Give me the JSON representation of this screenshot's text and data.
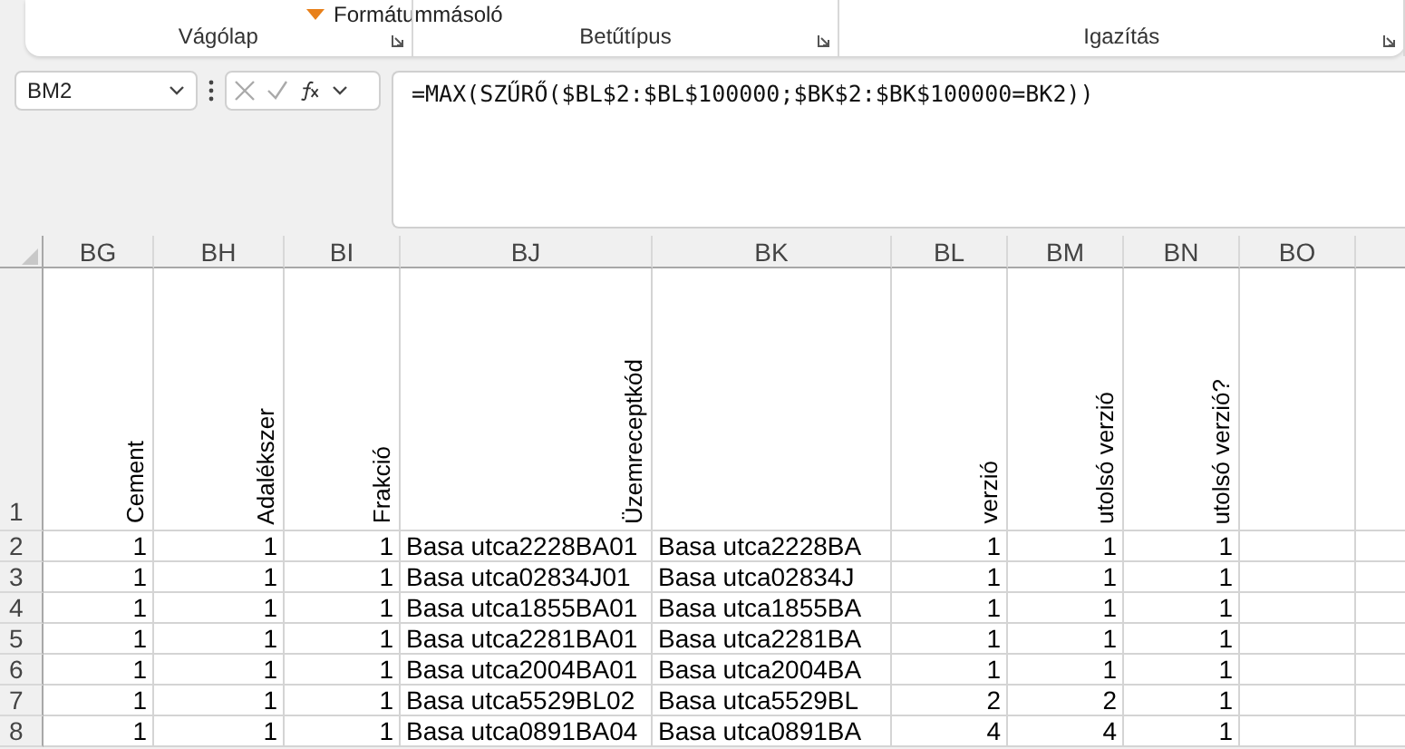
{
  "ribbon": {
    "top_item": "Formátummásoló",
    "groups": [
      {
        "label": "Vágólap"
      },
      {
        "label": "Betűtípus"
      },
      {
        "label": "Igazítás"
      }
    ]
  },
  "formula_bar": {
    "name_box": "BM2",
    "formula": "=MAX(SZŰRŐ($BL$2:$BL$100000;$BK$2:$BK$100000=BK2))"
  },
  "sheet": {
    "columns": [
      {
        "letter": "BG",
        "kind": "number",
        "header": "Cement"
      },
      {
        "letter": "BH",
        "kind": "number",
        "header": "Adalékszer"
      },
      {
        "letter": "BI",
        "kind": "number",
        "header": "Frakció"
      },
      {
        "letter": "BJ",
        "kind": "text",
        "header": "Üzemreceptkód"
      },
      {
        "letter": "BK",
        "kind": "text"
      },
      {
        "letter": "BL",
        "kind": "number",
        "header": "verzió"
      },
      {
        "letter": "BM",
        "kind": "number",
        "header": "utolsó verzió"
      },
      {
        "letter": "BN",
        "kind": "number",
        "header": "utolsó verzió?"
      },
      {
        "letter": "BO",
        "kind": "empty"
      },
      {
        "kind": "empty"
      }
    ],
    "header_row_number": "1",
    "rows": [
      {
        "number": "2",
        "cells": [
          "1",
          "1",
          "1",
          "Basa utca2228BA01",
          "Basa utca2228BA",
          "1",
          "1",
          "1"
        ]
      },
      {
        "number": "3",
        "cells": [
          "1",
          "1",
          "1",
          "Basa utca02834J01",
          "Basa utca02834J",
          "1",
          "1",
          "1"
        ]
      },
      {
        "number": "4",
        "cells": [
          "1",
          "1",
          "1",
          "Basa utca1855BA01",
          "Basa utca1855BA",
          "1",
          "1",
          "1"
        ]
      },
      {
        "number": "5",
        "cells": [
          "1",
          "1",
          "1",
          "Basa utca2281BA01",
          "Basa utca2281BA",
          "1",
          "1",
          "1"
        ]
      },
      {
        "number": "6",
        "cells": [
          "1",
          "1",
          "1",
          "Basa utca2004BA01",
          "Basa utca2004BA",
          "1",
          "1",
          "1"
        ]
      },
      {
        "number": "7",
        "cells": [
          "1",
          "1",
          "1",
          "Basa utca5529BL02",
          "Basa utca5529BL",
          "2",
          "2",
          "1"
        ]
      },
      {
        "number": "8",
        "cells": [
          "1",
          "1",
          "1",
          "Basa utca0891BA04",
          "Basa utca0891BA",
          "4",
          "4",
          "1"
        ]
      }
    ]
  }
}
